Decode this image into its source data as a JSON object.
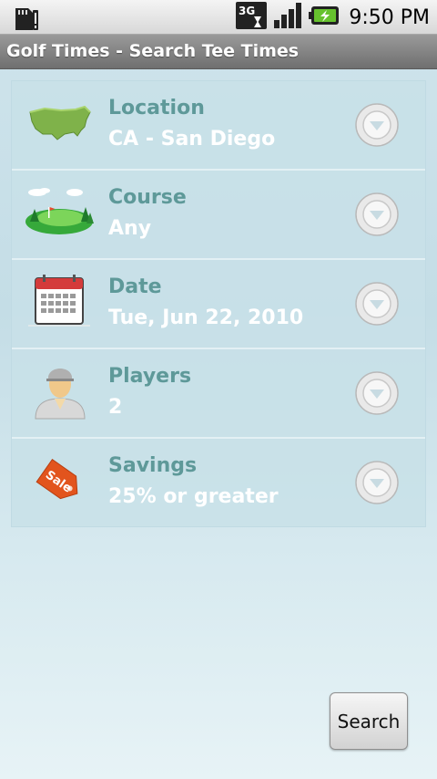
{
  "status_bar": {
    "time": "9:50 PM",
    "network": "3G"
  },
  "app": {
    "title": "Golf Times - Search Tee Times"
  },
  "rows": [
    {
      "label": "Location",
      "value": "CA - San Diego",
      "icon": "us-map-icon"
    },
    {
      "label": "Course",
      "value": "Any",
      "icon": "golf-course-icon"
    },
    {
      "label": "Date",
      "value": "Tue, Jun 22, 2010",
      "icon": "calendar-icon"
    },
    {
      "label": "Players",
      "value": "2",
      "icon": "player-icon"
    },
    {
      "label": "Savings",
      "value": "25% or greater",
      "icon": "sale-tag-icon"
    }
  ],
  "actions": {
    "search_label": "Search"
  },
  "colors": {
    "label": "#5e9999",
    "value": "#ffffff",
    "titlebar": "#808080"
  }
}
